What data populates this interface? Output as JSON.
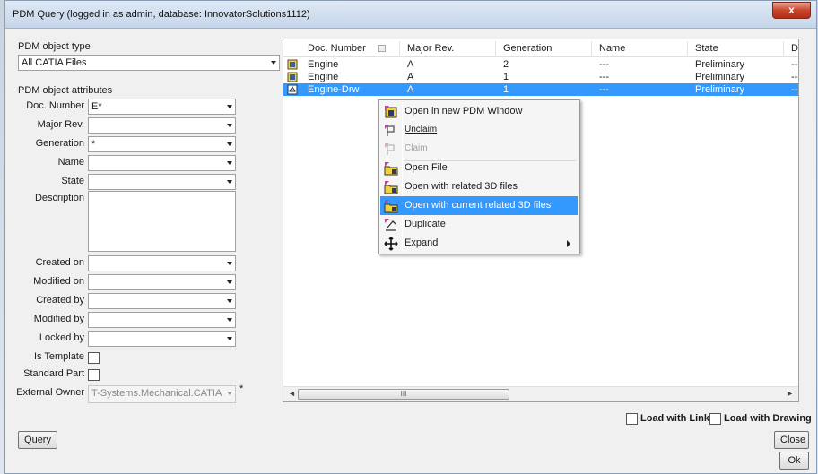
{
  "window": {
    "title": "PDM Query (logged in as admin, database: InnovatorSolutions1112)",
    "close_glyph": "x"
  },
  "left": {
    "object_type_label": "PDM object type",
    "object_type_value": "All CATIA Files",
    "attributes_label": "PDM object attributes",
    "fields": {
      "doc_number": {
        "label": "Doc. Number",
        "value": "E*"
      },
      "major_rev": {
        "label": "Major Rev.",
        "value": ""
      },
      "generation": {
        "label": "Generation",
        "value": "*"
      },
      "name": {
        "label": "Name",
        "value": ""
      },
      "state": {
        "label": "State",
        "value": ""
      },
      "description": {
        "label": "Description",
        "value": ""
      },
      "created_on": {
        "label": "Created on",
        "value": ""
      },
      "modified_on": {
        "label": "Modified on",
        "value": ""
      },
      "created_by": {
        "label": "Created by",
        "value": ""
      },
      "modified_by": {
        "label": "Modified by",
        "value": ""
      },
      "locked_by": {
        "label": "Locked by",
        "value": ""
      }
    },
    "is_template_label": "Is Template",
    "standard_part_label": "Standard Part",
    "external_owner_label": "External Owner",
    "external_owner_value": "T-Systems.Mechanical.CATIA",
    "external_owner_required": "*"
  },
  "table": {
    "columns": [
      "Doc. Number",
      "Major Rev.",
      "Generation",
      "Name",
      "State",
      "De"
    ],
    "rows": [
      {
        "doc": "Engine",
        "rev": "A",
        "gen": "2",
        "name": "---",
        "state": "Preliminary",
        "desc": "---"
      },
      {
        "doc": "Engine",
        "rev": "A",
        "gen": "1",
        "name": "---",
        "state": "Preliminary",
        "desc": "---"
      },
      {
        "doc": "Engine-Drw",
        "rev": "A",
        "gen": "1",
        "name": "---",
        "state": "Preliminary",
        "desc": "---"
      }
    ],
    "scroll_thumb_glyph": "III"
  },
  "context_menu": {
    "items": [
      {
        "label": "Open in new PDM Window",
        "icon": "pdm-window-icon"
      },
      {
        "label": "Unclaim",
        "icon": "unclaim-icon"
      },
      {
        "label": "Claim",
        "icon": "claim-icon"
      },
      {
        "label": "Open File",
        "icon": "open-file-icon"
      },
      {
        "label": "Open with related 3D files",
        "icon": "open-related-icon"
      },
      {
        "label": "Open with current related 3D files",
        "icon": "open-current-related-icon"
      },
      {
        "label": "Duplicate",
        "icon": "duplicate-icon"
      },
      {
        "label": "Expand",
        "icon": "expand-icon"
      }
    ]
  },
  "footer": {
    "load_with_links": "Load with Links",
    "load_with_drawing": "Load with Drawing",
    "query": "Query",
    "close": "Close",
    "ok": "Ok"
  },
  "colors": {
    "selection": "#3399ff",
    "close_red": "#c9462c"
  }
}
